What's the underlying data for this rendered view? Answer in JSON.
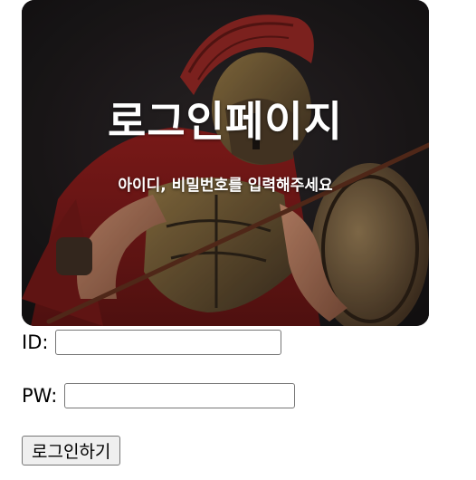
{
  "hero": {
    "title": "로그인페이지",
    "subtitle": "아이디, 비밀번호를 입력해주세요",
    "image": "spartan-warrior-illustration"
  },
  "form": {
    "id_label": "ID:",
    "id_value": "",
    "pw_label": "PW:",
    "pw_value": "",
    "submit_label": "로그인하기"
  }
}
